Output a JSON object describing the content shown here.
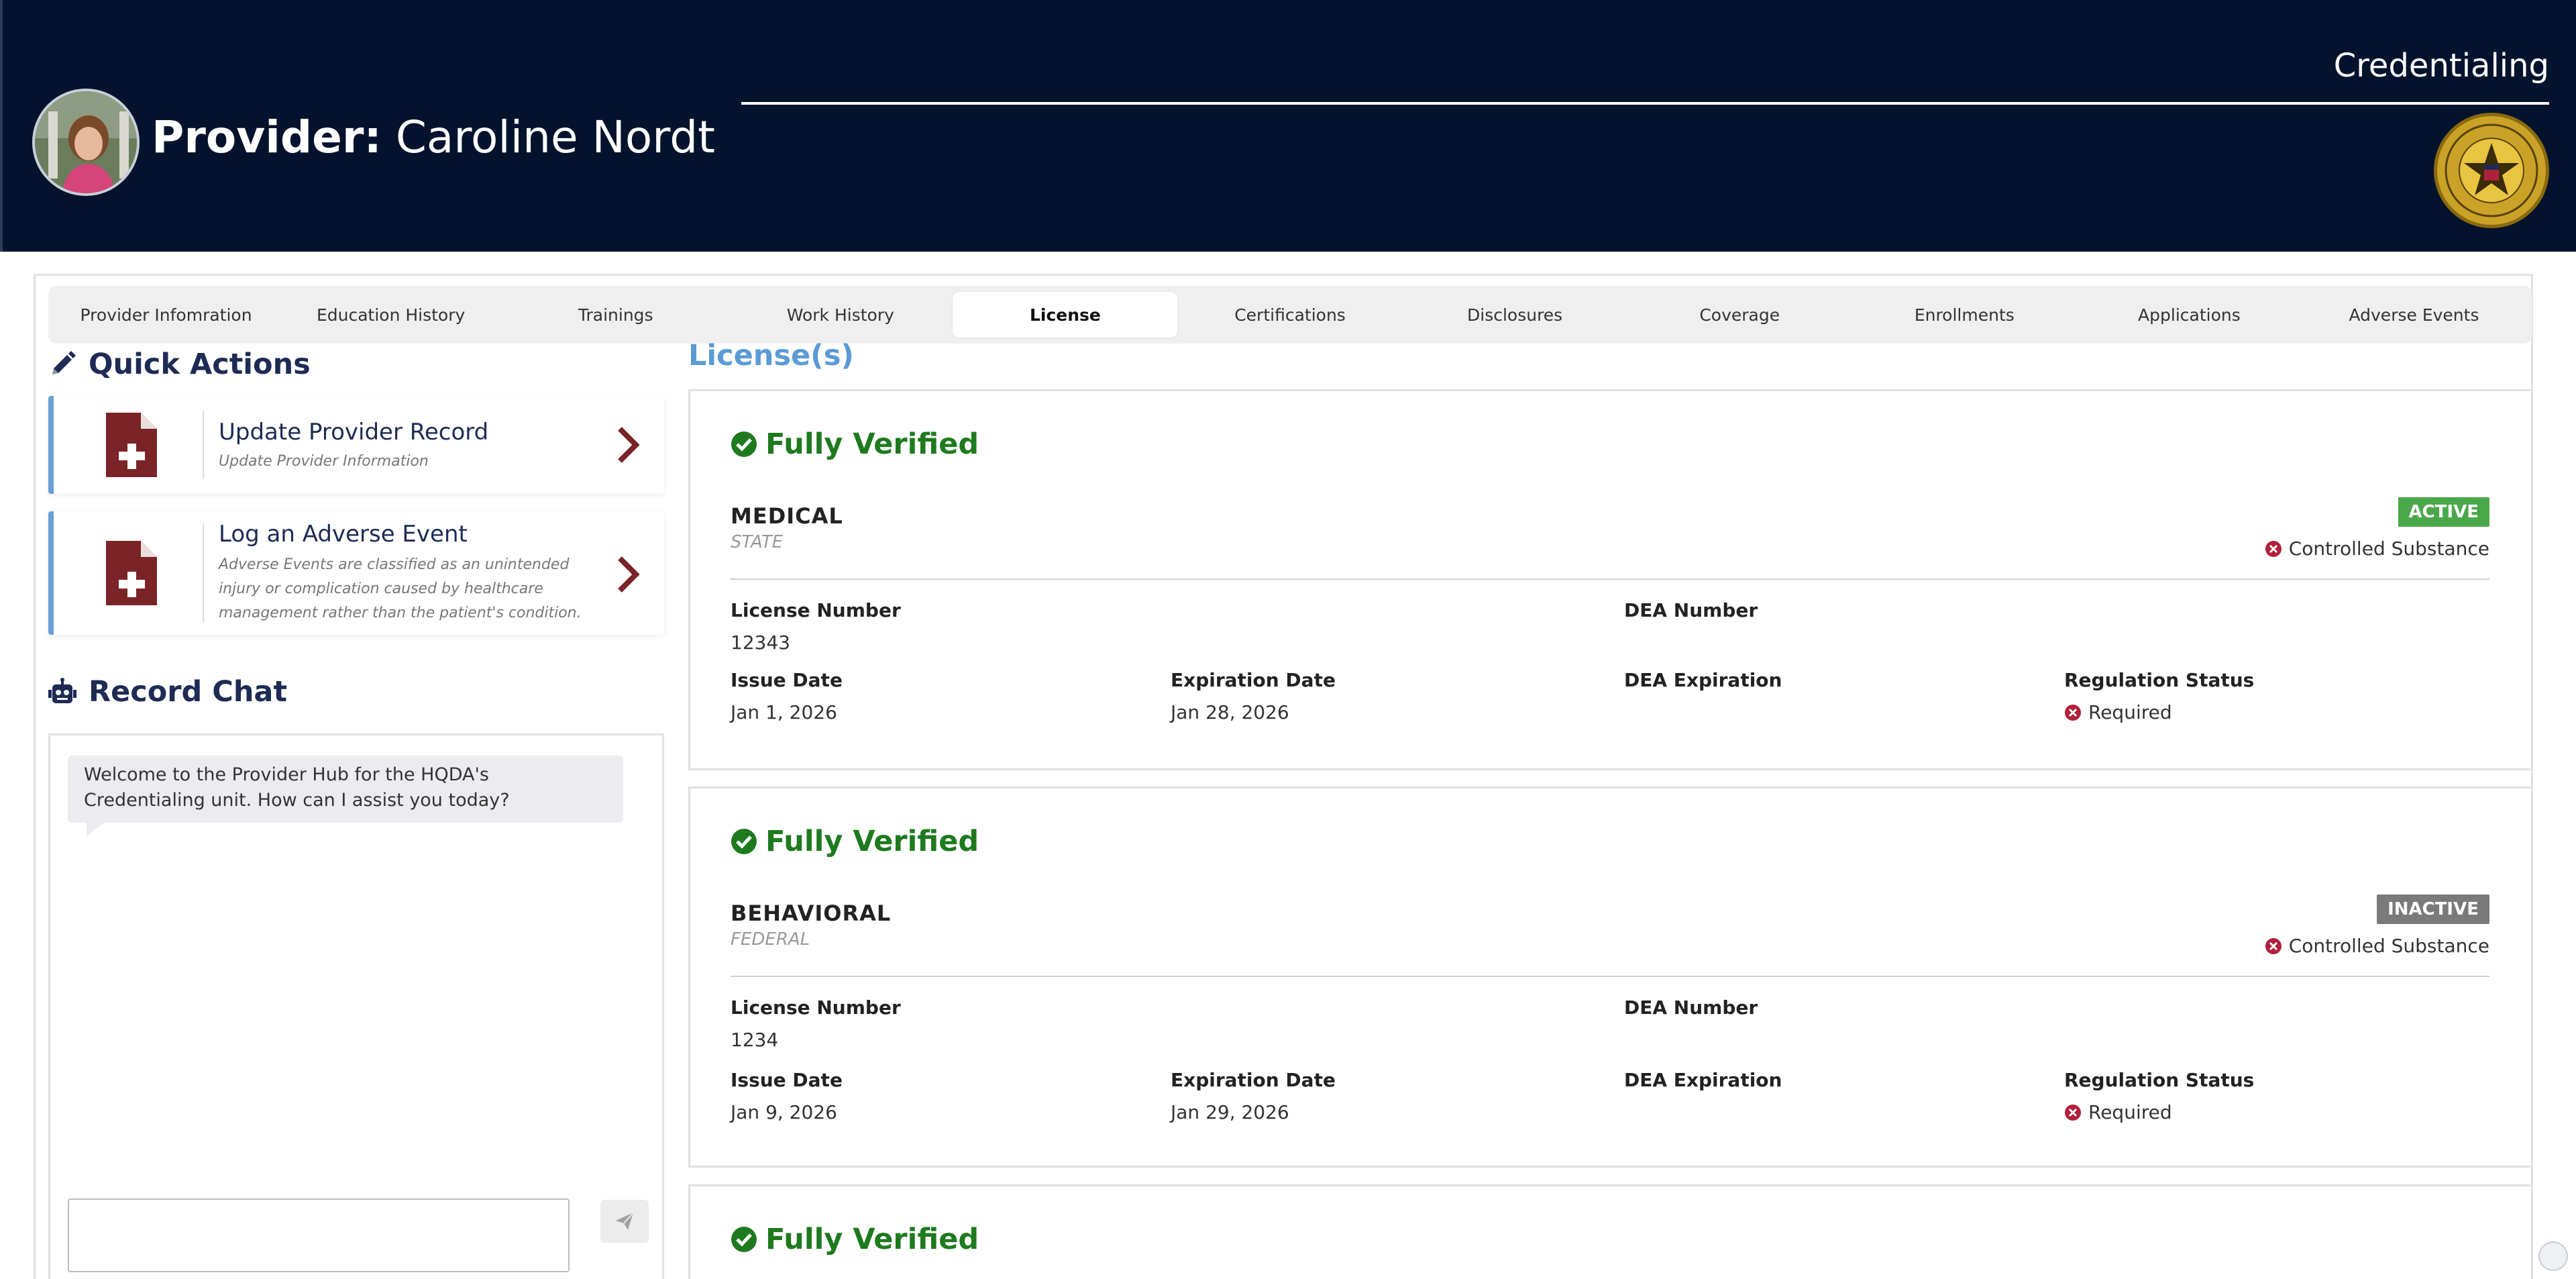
{
  "header": {
    "provider_label": "Provider:",
    "provider_name": "Caroline Nordt",
    "app_title": "Credentialing"
  },
  "tabs": [
    {
      "label": "Provider Infomration",
      "active": false
    },
    {
      "label": "Education History",
      "active": false
    },
    {
      "label": "Trainings",
      "active": false
    },
    {
      "label": "Work History",
      "active": false
    },
    {
      "label": "License",
      "active": true
    },
    {
      "label": "Certifications",
      "active": false
    },
    {
      "label": "Disclosures",
      "active": false
    },
    {
      "label": "Coverage",
      "active": false
    },
    {
      "label": "Enrollments",
      "active": false
    },
    {
      "label": "Applications",
      "active": false
    },
    {
      "label": "Adverse Events",
      "active": false
    }
  ],
  "quick_actions": {
    "title": "Quick Actions",
    "items": [
      {
        "title": "Update Provider Record",
        "subtitle": "Update Provider Information"
      },
      {
        "title": "Log an Adverse Event",
        "subtitle": "Adverse Events are classified as an unintended injury or complication caused by healthcare management rather than the patient's condition."
      }
    ]
  },
  "chat": {
    "title": "Record Chat",
    "welcome": "Welcome to the Provider Hub for the HQDA's Credentialing unit. How can I assist you today?",
    "input_value": ""
  },
  "licenses": {
    "title": "License(s)",
    "labels": {
      "license_number": "License Number",
      "dea_number": "DEA Number",
      "issue_date": "Issue Date",
      "expiration_date": "Expiration Date",
      "dea_expiration": "DEA Expiration",
      "regulation_status": "Regulation Status",
      "controlled_substance": "Controlled Substance"
    },
    "items": [
      {
        "verification": "Fully Verified",
        "type": "MEDICAL",
        "scope": "STATE",
        "status": "ACTIVE",
        "license_number": "12343",
        "issue_date": "Jan 1, 2026",
        "expiration_date": "Jan 28, 2026",
        "regulation_status": "Required"
      },
      {
        "verification": "Fully Verified",
        "type": "BEHAVIORAL",
        "scope": "FEDERAL",
        "status": "INACTIVE",
        "license_number": "1234",
        "issue_date": "Jan 9, 2026",
        "expiration_date": "Jan 29, 2026",
        "regulation_status": "Required"
      },
      {
        "verification": "Fully Verified"
      }
    ]
  },
  "colors": {
    "header_bg": "#03132e",
    "verified_green": "#1e7a1e",
    "active_badge": "#4aa84a",
    "inactive_badge": "#7a7a7a",
    "error_red": "#b0213c",
    "doc_icon": "#7a2427",
    "accent_blue": "#5b9bd5"
  },
  "icons": {
    "quick_actions": "pencil-icon",
    "record_chat": "robot-icon",
    "quick_action_doc": "medical-document-icon",
    "quick_action_go": "chevron-right-icon",
    "verified": "check-circle-icon",
    "not_held": "x-circle-icon",
    "send": "paper-plane-icon"
  }
}
